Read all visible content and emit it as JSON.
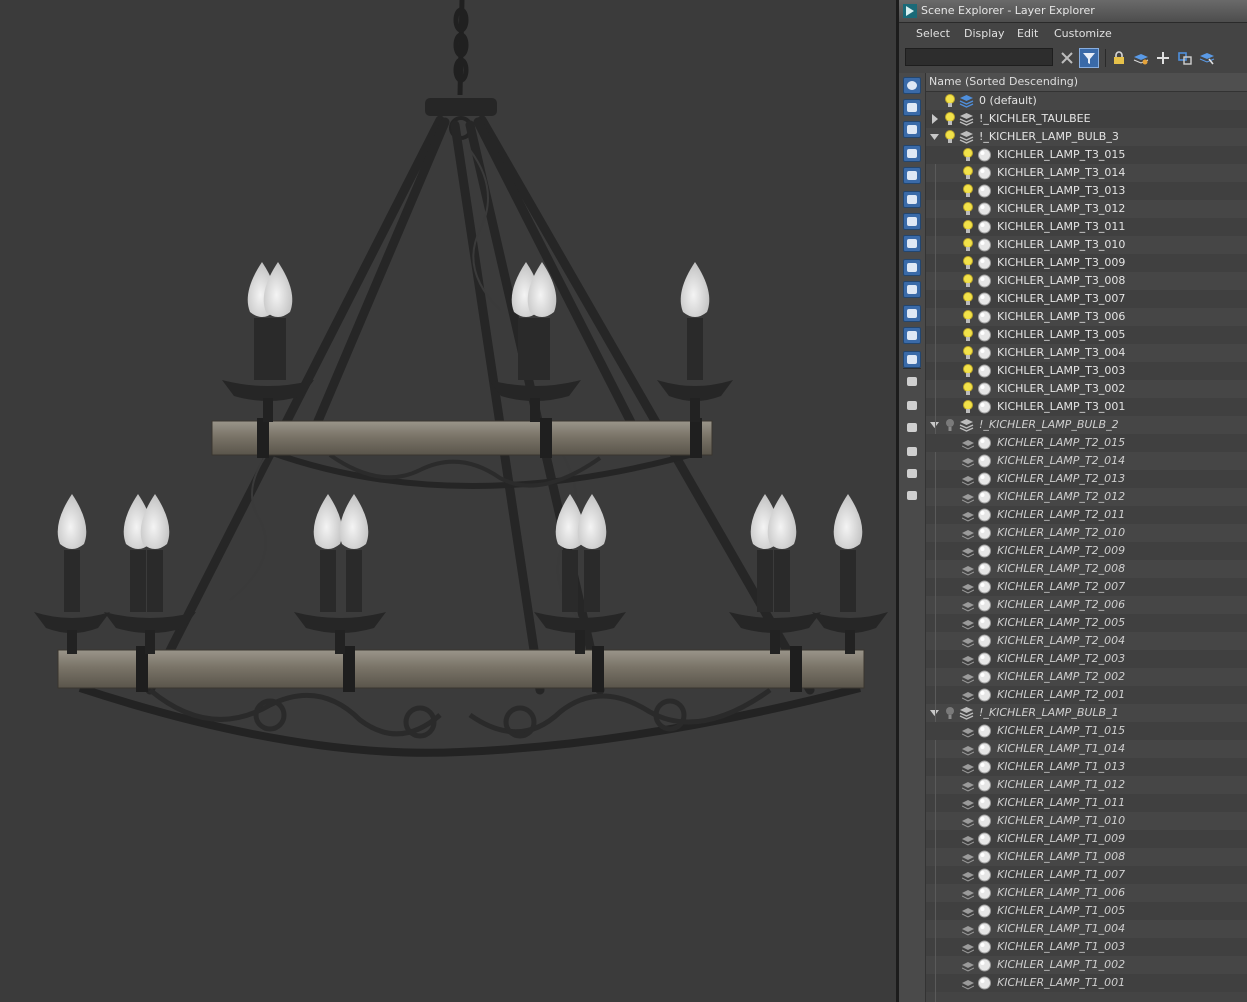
{
  "window": {
    "title": "Scene Explorer - Layer Explorer",
    "accent": "#3a6aa8",
    "background": "#3b3b3b"
  },
  "menu": [
    {
      "label": "Select"
    },
    {
      "label": "Display"
    },
    {
      "label": "Edit"
    },
    {
      "label": "Customize"
    }
  ],
  "search": {
    "value": "",
    "placeholder": ""
  },
  "toolbar": {
    "buttons": [
      "clear-search-icon",
      "filter-icon",
      "lock-icon",
      "new-layer-icon",
      "add-icon",
      "select-children-icon",
      "active-layer-icon"
    ]
  },
  "list": {
    "column_header": "Name (Sorted Descending)",
    "rows": [
      {
        "label": "0 (default)",
        "level": 0,
        "kind": "layer",
        "expander": "none",
        "visible": true
      },
      {
        "label": "!_KICHLER_TAULBEE",
        "level": 0,
        "kind": "layer",
        "expander": "collapsed",
        "visible": true
      },
      {
        "label": "!_KICHLER_LAMP_BULB_3",
        "level": 0,
        "kind": "layer",
        "expander": "expanded",
        "visible": true
      },
      {
        "label": "KICHLER_LAMP_T3_015",
        "level": 1,
        "kind": "object",
        "visible": true
      },
      {
        "label": "KICHLER_LAMP_T3_014",
        "level": 1,
        "kind": "object",
        "visible": true
      },
      {
        "label": "KICHLER_LAMP_T3_013",
        "level": 1,
        "kind": "object",
        "visible": true
      },
      {
        "label": "KICHLER_LAMP_T3_012",
        "level": 1,
        "kind": "object",
        "visible": true
      },
      {
        "label": "KICHLER_LAMP_T3_011",
        "level": 1,
        "kind": "object",
        "visible": true
      },
      {
        "label": "KICHLER_LAMP_T3_010",
        "level": 1,
        "kind": "object",
        "visible": true
      },
      {
        "label": "KICHLER_LAMP_T3_009",
        "level": 1,
        "kind": "object",
        "visible": true
      },
      {
        "label": "KICHLER_LAMP_T3_008",
        "level": 1,
        "kind": "object",
        "visible": true
      },
      {
        "label": "KICHLER_LAMP_T3_007",
        "level": 1,
        "kind": "object",
        "visible": true
      },
      {
        "label": "KICHLER_LAMP_T3_006",
        "level": 1,
        "kind": "object",
        "visible": true
      },
      {
        "label": "KICHLER_LAMP_T3_005",
        "level": 1,
        "kind": "object",
        "visible": true
      },
      {
        "label": "KICHLER_LAMP_T3_004",
        "level": 1,
        "kind": "object",
        "visible": true
      },
      {
        "label": "KICHLER_LAMP_T3_003",
        "level": 1,
        "kind": "object",
        "visible": true
      },
      {
        "label": "KICHLER_LAMP_T3_002",
        "level": 1,
        "kind": "object",
        "visible": true
      },
      {
        "label": "KICHLER_LAMP_T3_001",
        "level": 1,
        "kind": "object",
        "visible": true
      },
      {
        "label": "!_KICHLER_LAMP_BULB_2",
        "level": 0,
        "kind": "layer",
        "expander": "expanded",
        "visible": false
      },
      {
        "label": "KICHLER_LAMP_T2_015",
        "level": 1,
        "kind": "object",
        "visible": false
      },
      {
        "label": "KICHLER_LAMP_T2_014",
        "level": 1,
        "kind": "object",
        "visible": false
      },
      {
        "label": "KICHLER_LAMP_T2_013",
        "level": 1,
        "kind": "object",
        "visible": false
      },
      {
        "label": "KICHLER_LAMP_T2_012",
        "level": 1,
        "kind": "object",
        "visible": false
      },
      {
        "label": "KICHLER_LAMP_T2_011",
        "level": 1,
        "kind": "object",
        "visible": false
      },
      {
        "label": "KICHLER_LAMP_T2_010",
        "level": 1,
        "kind": "object",
        "visible": false
      },
      {
        "label": "KICHLER_LAMP_T2_009",
        "level": 1,
        "kind": "object",
        "visible": false
      },
      {
        "label": "KICHLER_LAMP_T2_008",
        "level": 1,
        "kind": "object",
        "visible": false
      },
      {
        "label": "KICHLER_LAMP_T2_007",
        "level": 1,
        "kind": "object",
        "visible": false
      },
      {
        "label": "KICHLER_LAMP_T2_006",
        "level": 1,
        "kind": "object",
        "visible": false
      },
      {
        "label": "KICHLER_LAMP_T2_005",
        "level": 1,
        "kind": "object",
        "visible": false
      },
      {
        "label": "KICHLER_LAMP_T2_004",
        "level": 1,
        "kind": "object",
        "visible": false
      },
      {
        "label": "KICHLER_LAMP_T2_003",
        "level": 1,
        "kind": "object",
        "visible": false
      },
      {
        "label": "KICHLER_LAMP_T2_002",
        "level": 1,
        "kind": "object",
        "visible": false
      },
      {
        "label": "KICHLER_LAMP_T2_001",
        "level": 1,
        "kind": "object",
        "visible": false
      },
      {
        "label": "!_KICHLER_LAMP_BULB_1",
        "level": 0,
        "kind": "layer",
        "expander": "expanded",
        "visible": false
      },
      {
        "label": "KICHLER_LAMP_T1_015",
        "level": 1,
        "kind": "object",
        "visible": false
      },
      {
        "label": "KICHLER_LAMP_T1_014",
        "level": 1,
        "kind": "object",
        "visible": false
      },
      {
        "label": "KICHLER_LAMP_T1_013",
        "level": 1,
        "kind": "object",
        "visible": false
      },
      {
        "label": "KICHLER_LAMP_T1_012",
        "level": 1,
        "kind": "object",
        "visible": false
      },
      {
        "label": "KICHLER_LAMP_T1_011",
        "level": 1,
        "kind": "object",
        "visible": false
      },
      {
        "label": "KICHLER_LAMP_T1_010",
        "level": 1,
        "kind": "object",
        "visible": false
      },
      {
        "label": "KICHLER_LAMP_T1_009",
        "level": 1,
        "kind": "object",
        "visible": false
      },
      {
        "label": "KICHLER_LAMP_T1_008",
        "level": 1,
        "kind": "object",
        "visible": false
      },
      {
        "label": "KICHLER_LAMP_T1_007",
        "level": 1,
        "kind": "object",
        "visible": false
      },
      {
        "label": "KICHLER_LAMP_T1_006",
        "level": 1,
        "kind": "object",
        "visible": false
      },
      {
        "label": "KICHLER_LAMP_T1_005",
        "level": 1,
        "kind": "object",
        "visible": false
      },
      {
        "label": "KICHLER_LAMP_T1_004",
        "level": 1,
        "kind": "object",
        "visible": false
      },
      {
        "label": "KICHLER_LAMP_T1_003",
        "level": 1,
        "kind": "object",
        "visible": false
      },
      {
        "label": "KICHLER_LAMP_T1_002",
        "level": 1,
        "kind": "object",
        "visible": false
      },
      {
        "label": "KICHLER_LAMP_T1_001",
        "level": 1,
        "kind": "object",
        "visible": false
      }
    ]
  },
  "left_strip": {
    "buttons": [
      "display-none-icon",
      "display-all-icon",
      "invert-display-icon",
      "geometry-filter-icon",
      "shapes-filter-icon",
      "lights-filter-icon",
      "cameras-filter-icon",
      "helpers-filter-icon",
      "spacewarps-filter-icon",
      "groups-filter-icon",
      "xrefs-filter-icon",
      "bones-filter-icon",
      "containers-filter-icon",
      "frozen-filter-icon",
      "hidden-filter-icon",
      "last-filter-icon",
      "filter-funnel-icon",
      "filter-settings-icon",
      "filter-toggle-icon"
    ]
  }
}
